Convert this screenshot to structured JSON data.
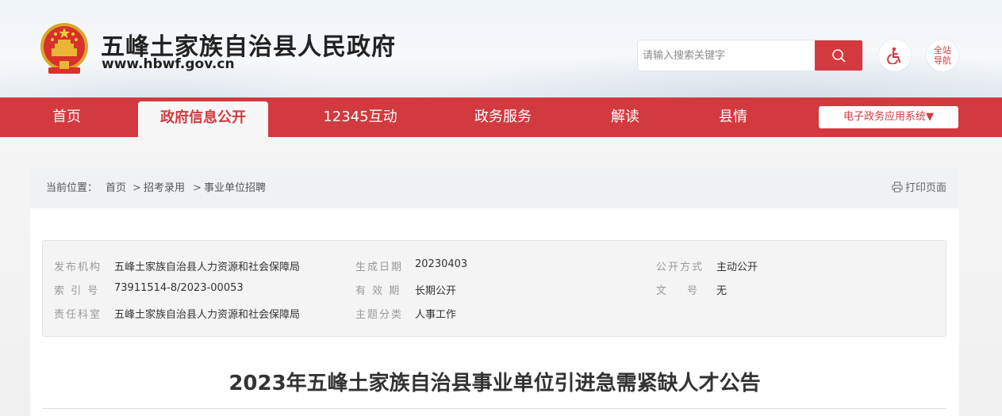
{
  "header": {
    "site_title": "五峰土家族自治县人民政府",
    "site_url": "www.hbwf.gov.cn",
    "search_placeholder": "请输入搜索关键字",
    "site_nav_line1": "全站",
    "site_nav_line2": "导航"
  },
  "nav": {
    "items": [
      {
        "label": "首页"
      },
      {
        "label": "政府信息公开"
      },
      {
        "label": "12345互动"
      },
      {
        "label": "政务服务"
      },
      {
        "label": "解读"
      },
      {
        "label": "县情"
      }
    ],
    "e_apps": "电子政务应用系统▼"
  },
  "breadcrumb": {
    "label": "当前位置：",
    "items": [
      "首页",
      "招考录用",
      "事业单位招聘"
    ],
    "separator": ">",
    "print": "打印页面"
  },
  "meta": {
    "publisher_label": "发布机构",
    "publisher": "五峰土家族自治县人力资源和社会保障局",
    "index_label": "索 引 号",
    "index": "73911514-8/2023-00053",
    "dept_label": "责任科室",
    "dept": "五峰土家族自治县人力资源和社会保障局",
    "date_label": "生成日期",
    "date": "20230403",
    "validity_label": "有 效 期",
    "validity": "长期公开",
    "category_label": "主题分类",
    "category": "人事工作",
    "mode_label": "公开方式",
    "mode": "主动公开",
    "docno_label": "文　　号",
    "docno": "无"
  },
  "article": {
    "title": "2023年五峰土家族自治县事业单位引进急需紧缺人才公告"
  },
  "colors": {
    "brand_red": "#d23a40",
    "nav_active_bg": "#f7f7f7"
  }
}
